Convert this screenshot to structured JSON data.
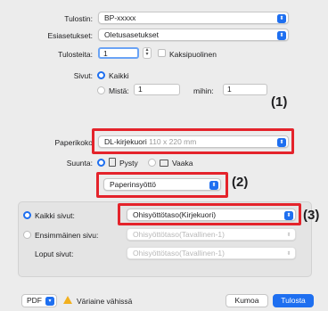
{
  "printer": {
    "label": "Tulostin:",
    "value": "BP-xxxxx"
  },
  "presets": {
    "label": "Esiasetukset:",
    "value": "Oletusasetukset"
  },
  "copies": {
    "label": "Tulosteita:",
    "value": "1",
    "two_sided_label": "Kaksipuolinen"
  },
  "pages": {
    "label": "Sivut:",
    "all_label": "Kaikki",
    "from_label": "Mistä:",
    "from_value": "1",
    "to_label": "mihin:",
    "to_value": "1"
  },
  "paper_size": {
    "label": "Paperikoko",
    "value": "DL-kirjekuori",
    "dims": "110 x 220 mm"
  },
  "orientation": {
    "label": "Suunta:",
    "portrait_icon": "▪⃣",
    "portrait_label": "Pysty",
    "landscape_label": "Vaaka"
  },
  "section_menu": {
    "value": "Paperinsyöttö"
  },
  "paper_feed": {
    "all_pages_label": "Kaikki sivut:",
    "all_pages_value": "Ohisyöttötaso(Kirjekuori)",
    "first_page_label": "Ensimmäinen sivu:",
    "first_page_value": "Ohisyöttötaso(Tavallinen-1)",
    "remaining_label": "Loput sivut:",
    "remaining_value": "Ohisyöttötaso(Tavallinen-1)"
  },
  "footer": {
    "pdf_label": "PDF",
    "warning_text": "Väriaine vähissä",
    "cancel_label": "Kumoa",
    "print_label": "Tulosta"
  },
  "callouts": {
    "c1": "(1)",
    "c2": "(2)",
    "c3": "(3)"
  },
  "colors": {
    "accent": "#1e6ff0",
    "highlight": "#e4232b",
    "warning": "#f2b01e"
  }
}
